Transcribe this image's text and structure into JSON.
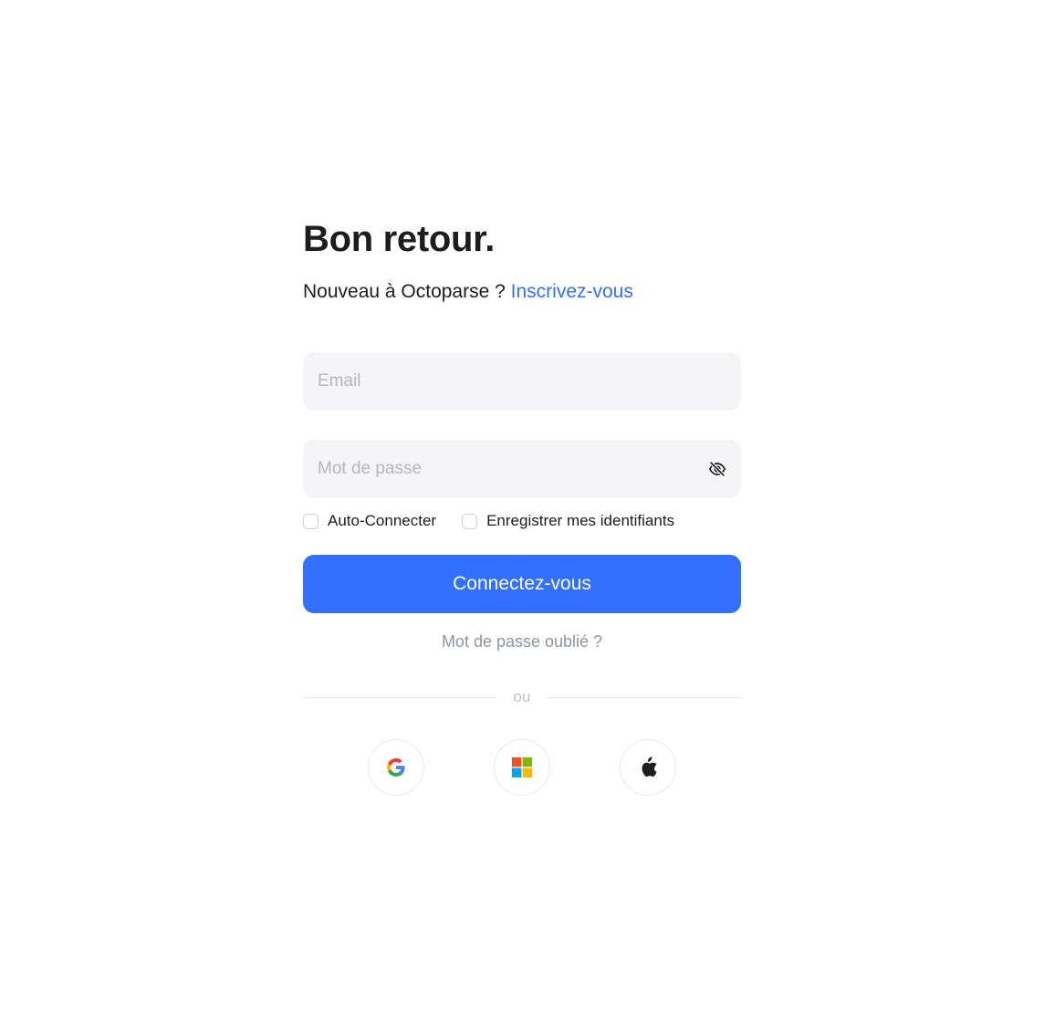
{
  "header": {
    "title": "Bon retour.",
    "subtitle_text": "Nouveau à Octoparse ?",
    "signup_link": "Inscrivez-vous"
  },
  "form": {
    "email_placeholder": "Email",
    "email_value": "",
    "password_placeholder": "Mot de passe",
    "password_value": "",
    "password_toggle_icon": "eye-off-icon",
    "auto_login_label": "Auto-Connecter",
    "auto_login_checked": false,
    "remember_label": "Enregistrer mes identifiants",
    "remember_checked": false,
    "submit_label": "Connectez-vous",
    "forgot_label": "Mot de passe oublié ?"
  },
  "divider": {
    "label": "ou"
  },
  "social": [
    {
      "provider": "google",
      "icon": "google-icon"
    },
    {
      "provider": "microsoft",
      "icon": "microsoft-icon"
    },
    {
      "provider": "apple",
      "icon": "apple-icon"
    }
  ],
  "colors": {
    "accent": "#3370ff",
    "input_bg": "#f5f5f7",
    "placeholder": "#b3b7bf",
    "muted_text": "#8f959e"
  }
}
